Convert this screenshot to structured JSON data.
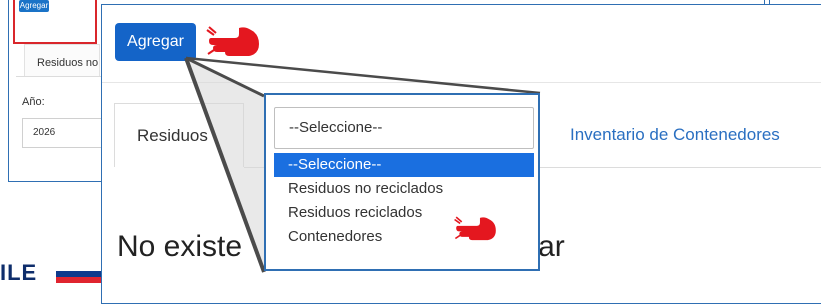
{
  "background": {
    "button": "Agregar",
    "tab": "Residuos no",
    "year_label": "Año:",
    "year_value": "2026"
  },
  "footer": {
    "logo_text": "ILE"
  },
  "zoom": {
    "button": "Agregar",
    "tab_residuos": "Residuos",
    "tab_inventario": "Inventario de Contenedores",
    "heading_left": "No existe",
    "heading_right": "ostrar"
  },
  "dropdown": {
    "current": "--Seleccione--",
    "options": [
      {
        "label": "--Seleccione--",
        "selected": true
      },
      {
        "label": "Residuos no reciclados",
        "selected": false
      },
      {
        "label": "Residuos reciclados",
        "selected": false
      },
      {
        "label": "Contenedores",
        "selected": false
      }
    ]
  },
  "colors": {
    "primary": "#1464c8",
    "frame": "#2f6fb3",
    "highlight": "#d9262b",
    "selected_option": "#1a6fe0",
    "logo_blue": "#0e2d6b"
  }
}
